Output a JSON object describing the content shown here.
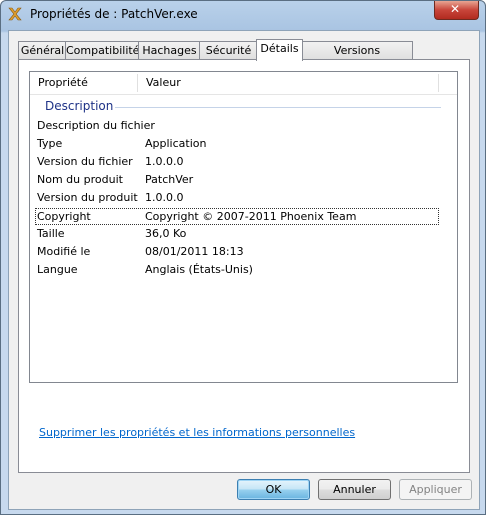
{
  "window": {
    "title": "Propriétés de : PatchVer.exe",
    "close_glyph": "✕"
  },
  "tabs": [
    "Général",
    "Compatibilité",
    "Hachages",
    "Sécurité",
    "Détails",
    "Versions précédentes"
  ],
  "active_tab": "Détails",
  "columns": {
    "property": "Propriété",
    "value": "Valeur"
  },
  "group": "Description",
  "rows": [
    {
      "p": "Description du fichier",
      "v": ""
    },
    {
      "p": "Type",
      "v": "Application"
    },
    {
      "p": "Version du fichier",
      "v": "1.0.0.0"
    },
    {
      "p": "Nom du produit",
      "v": "PatchVer"
    },
    {
      "p": "Version du produit",
      "v": "1.0.0.0"
    },
    {
      "p": "Copyright",
      "v": "Copyright © 2007-2011 Phoenix Team"
    },
    {
      "p": "Taille",
      "v": "36,0 Ko"
    },
    {
      "p": "Modifié le",
      "v": "08/01/2011 18:13"
    },
    {
      "p": "Langue",
      "v": "Anglais (États-Unis)"
    }
  ],
  "link": "Supprimer les propriétés et les informations personnelles",
  "buttons": {
    "ok": "OK",
    "cancel": "Annuler",
    "apply": "Appliquer"
  }
}
